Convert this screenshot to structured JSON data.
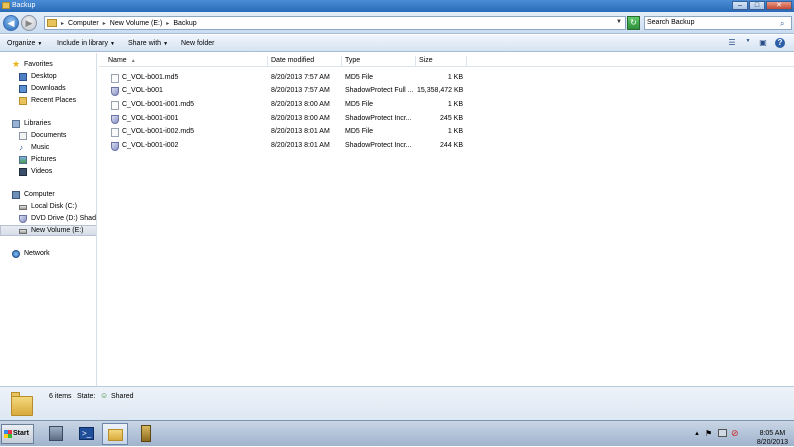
{
  "window": {
    "title": "Backup",
    "controls": {
      "minimize": "–",
      "maximize": "□",
      "close": "✕"
    }
  },
  "address": {
    "breadcrumb": [
      "Computer",
      "New Volume (E:)",
      "Backup"
    ],
    "search_placeholder": "Search Backup"
  },
  "toolbar": {
    "organize": "Organize",
    "include_in_library": "Include in library",
    "share_with": "Share with",
    "new_folder": "New folder"
  },
  "nav": {
    "favorites": {
      "label": "Favorites",
      "items": [
        "Desktop",
        "Downloads",
        "Recent Places"
      ]
    },
    "libraries": {
      "label": "Libraries",
      "items": [
        "Documents",
        "Music",
        "Pictures",
        "Videos"
      ]
    },
    "computer": {
      "label": "Computer",
      "items": [
        "Local Disk (C:)",
        "DVD Drive (D:) Shadov",
        "New Volume (E:)"
      ]
    },
    "network": {
      "label": "Network"
    }
  },
  "columns": {
    "name": "Name",
    "date": "Date modified",
    "type": "Type",
    "size": "Size"
  },
  "files": [
    {
      "name": "C_VOL-b001.md5",
      "date": "8/20/2013 7:57 AM",
      "type": "MD5 File",
      "size": "1 KB",
      "icon": "md5"
    },
    {
      "name": "C_VOL-b001",
      "date": "8/20/2013 7:57 AM",
      "type": "ShadowProtect Full ...",
      "size": "15,358,472 KB",
      "icon": "shadowprotect"
    },
    {
      "name": "C_VOL-b001-i001.md5",
      "date": "8/20/2013 8:00 AM",
      "type": "MD5 File",
      "size": "1 KB",
      "icon": "md5"
    },
    {
      "name": "C_VOL-b001-i001",
      "date": "8/20/2013 8:00 AM",
      "type": "ShadowProtect Incr...",
      "size": "245 KB",
      "icon": "shadowprotect"
    },
    {
      "name": "C_VOL-b001-i002.md5",
      "date": "8/20/2013 8:01 AM",
      "type": "MD5 File",
      "size": "1 KB",
      "icon": "md5"
    },
    {
      "name": "C_VOL-b001-i002",
      "date": "8/20/2013 8:01 AM",
      "type": "ShadowProtect Incr...",
      "size": "244 KB",
      "icon": "shadowprotect"
    }
  ],
  "details": {
    "count": "6 items",
    "state_label": "State:",
    "state_value": "Shared"
  },
  "taskbar": {
    "start": "Start",
    "time": "8:05 AM",
    "date": "8/20/2013"
  },
  "colors": {
    "titlebar": "#2a6bb8",
    "selection": "#d6dde7",
    "folder": "#e8c25a"
  }
}
